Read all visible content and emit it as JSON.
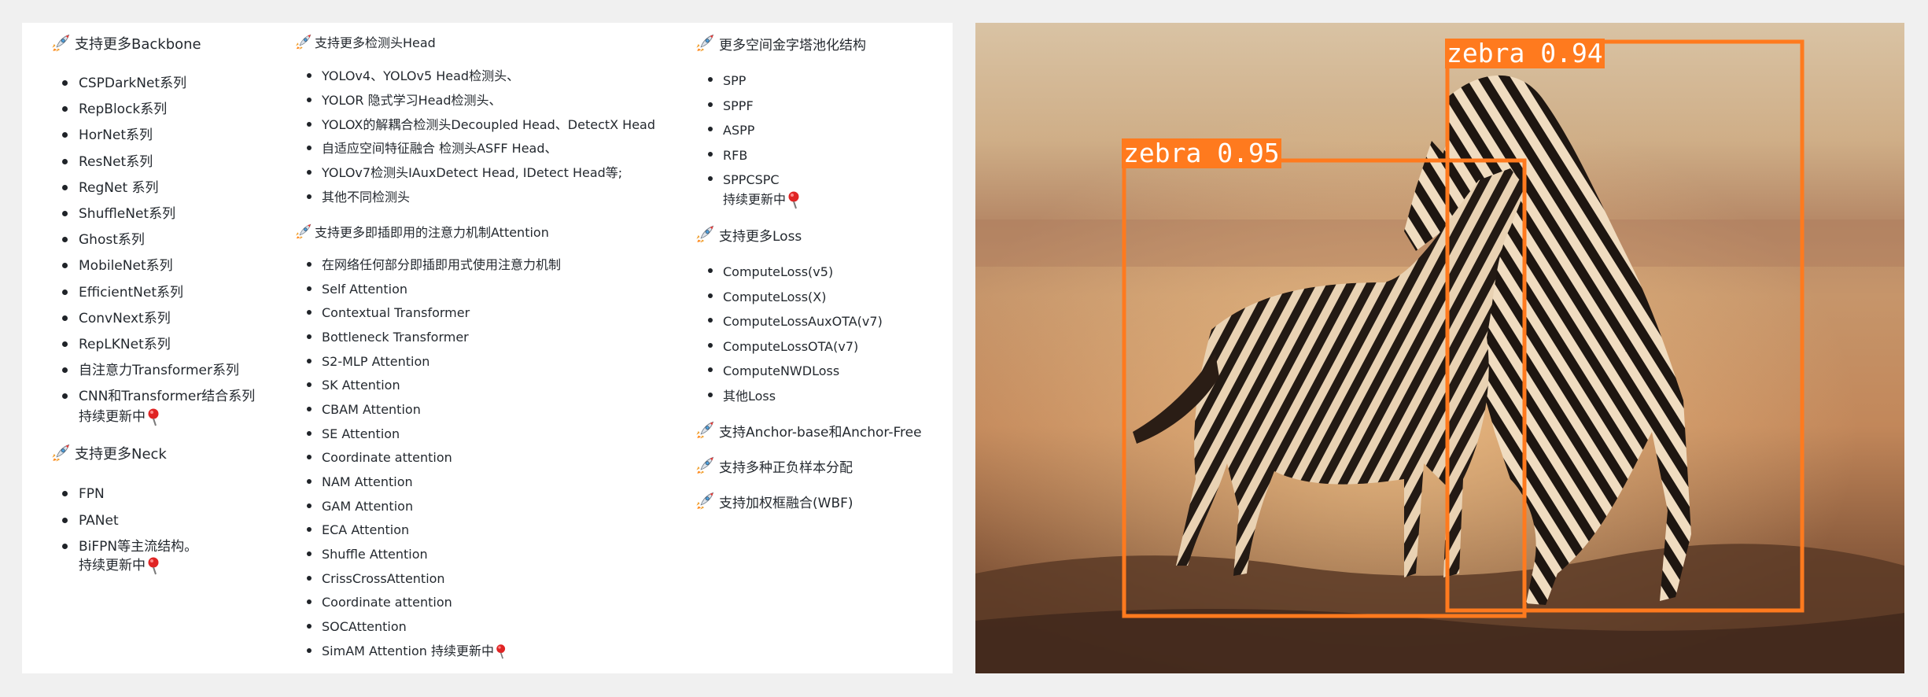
{
  "col1": {
    "backbone_title": "支持更多Backbone",
    "backbone_items": [
      "CSPDarkNet系列",
      "RepBlock系列",
      "HorNet系列",
      "ResNet系列",
      "RegNet 系列",
      "ShuffleNet系列",
      "Ghost系列",
      "MobileNet系列",
      "EfficientNet系列",
      "ConvNext系列",
      "RepLKNet系列",
      "自注意力Transformer系列",
      "CNN和Transformer结合系列"
    ],
    "backbone_cont": "持续更新中",
    "neck_title": "支持更多Neck",
    "neck_items": [
      "FPN",
      "PANet",
      "BiFPN等主流结构。"
    ],
    "neck_cont": "持续更新中"
  },
  "col2": {
    "head_title": "支持更多检测头Head",
    "head_items": [
      "YOLOv4、YOLOv5 Head检测头、",
      "YOLOR 隐式学习Head检测头、",
      "YOLOX的解耦合检测头Decoupled Head、DetectX Head",
      "自适应空间特征融合 检测头ASFF Head、",
      "YOLOv7检测头IAuxDetect Head, IDetect Head等;",
      "其他不同检测头"
    ],
    "attn_title": "支持更多即插即用的注意力机制Attention",
    "attn_items": [
      "在网络任何部分即插即用式使用注意力机制",
      "Self Attention",
      "Contextual Transformer",
      "Bottleneck Transformer",
      "S2-MLP Attention",
      "SK Attention",
      "CBAM Attention",
      "SE Attention",
      "Coordinate attention",
      "NAM Attention",
      "GAM Attention",
      "ECA Attention",
      "Shuffle Attention",
      "CrissCrossAttention",
      "Coordinate attention",
      "SOCAttention"
    ],
    "attn_last": "SimAM Attention 持续更新中"
  },
  "col3": {
    "spp_title": "更多空间金字塔池化结构",
    "spp_items": [
      "SPP",
      "SPPF",
      "ASPP",
      "RFB"
    ],
    "spp_last": "SPPCSPC",
    "spp_cont": "持续更新中",
    "loss_title": "支持更多Loss",
    "loss_items": [
      "ComputeLoss(v5)",
      "ComputeLoss(X)",
      "ComputeLossAuxOTA(v7)",
      "ComputeLossOTA(v7)",
      "ComputeNWDLoss",
      "其他Loss"
    ],
    "anchor_title": "支持Anchor-base和Anchor-Free",
    "assign_title": "支持多种正负样本分配",
    "wbf_title": "支持加权框融合(WBF)"
  },
  "detection": {
    "det1_label": "zebra 0.95",
    "det2_label": "zebra 0.94",
    "box_color": "#ff7a1e"
  },
  "icons": {
    "section": "rocket-icon",
    "update": "pin-icon"
  }
}
